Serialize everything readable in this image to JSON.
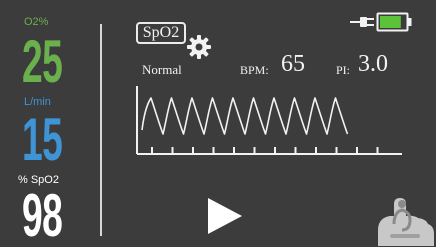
{
  "left_panel": {
    "o2_label": "O2%",
    "o2_value": "25",
    "flow_label": "L/min",
    "flow_value": "15",
    "spo2_label": "% SpO2",
    "spo2_value": "98"
  },
  "monitor": {
    "tab_label": "SpO2",
    "status": "Normal",
    "bpm_label": "BPM:",
    "bpm_value": "65",
    "pi_label": "PI:",
    "pi_value": "3.0"
  },
  "icons": {
    "settings": "gear-icon",
    "power": "plug-icon",
    "battery": "battery-icon",
    "play": "play-icon",
    "touch": "hand-icon"
  },
  "colors": {
    "background": "#3c3c3c",
    "o2": "#6ab04c",
    "flow": "#3f94d6",
    "spo2": "#ffffff",
    "battery_fill": "#5cc23a",
    "text": "#f2f2f2"
  },
  "battery_level": 0.8
}
